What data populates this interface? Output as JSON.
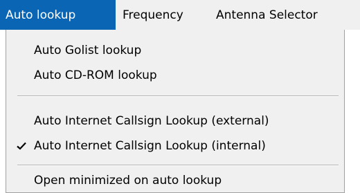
{
  "menubar": {
    "items": [
      {
        "label": "Auto lookup",
        "active": true
      },
      {
        "label": "Frequency",
        "active": false
      },
      {
        "label": "Antenna Selector",
        "active": false
      }
    ]
  },
  "dropdown": {
    "items": [
      {
        "label": "Auto Golist lookup",
        "checked": false
      },
      {
        "label": "Auto CD-ROM lookup",
        "checked": false
      },
      {
        "label": "Auto Internet Callsign Lookup (external)",
        "checked": false
      },
      {
        "label": "Auto Internet Callsign Lookup (internal)",
        "checked": true
      },
      {
        "label": "Open minimized on auto lookup",
        "checked": false
      }
    ]
  },
  "colors": {
    "menu_background": "#f0f0f0",
    "active_highlight": "#0a65b4",
    "separator": "#b4b4b4"
  }
}
